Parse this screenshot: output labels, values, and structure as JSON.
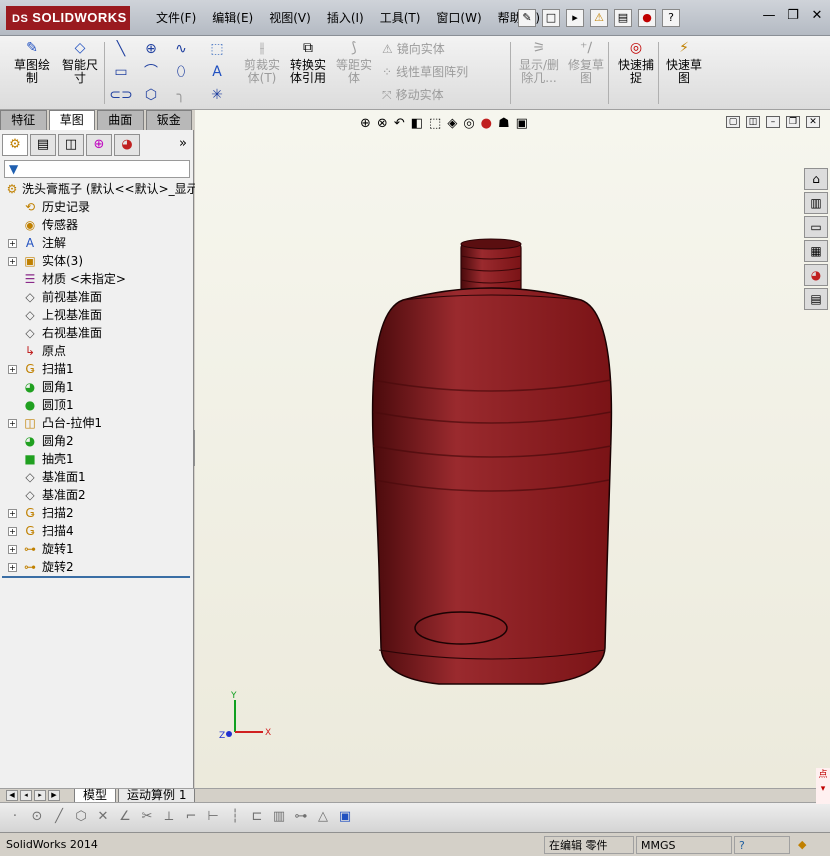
{
  "app": {
    "logo_text": "SOLIDWORKS",
    "logo_prefix": "DS"
  },
  "menus": [
    "文件(F)",
    "编辑(E)",
    "视图(V)",
    "插入(I)",
    "工具(T)",
    "窗口(W)",
    "帮助(H)"
  ],
  "titletools": [
    "pin-icon",
    "new-document-icon",
    "open-icon",
    "rebuild-warning-icon",
    "print-icon",
    "traffic-light-icon",
    "help-icon"
  ],
  "window_buttons": {
    "min": "—",
    "restore": "❐",
    "close": "✕"
  },
  "toolbar": {
    "sketch": "草图绘\n制",
    "smart_dim": "智能尺\n寸",
    "trim": "剪裁实\n体(T)",
    "convert": "转换实\n体引用",
    "offset": "等距实\n体",
    "mirror": "镜向实体",
    "linear_pattern": "线性草图阵列",
    "move": "移动实体",
    "show_delete": "显示/删\n除几...",
    "repair": "修复草\n图",
    "quick_snap": "快速捕\n捉",
    "rapid_sketch": "快速草\n图"
  },
  "cmd_tabs": [
    {
      "label": "特征",
      "active": false
    },
    {
      "label": "草图",
      "active": true
    },
    {
      "label": "曲面",
      "active": false
    },
    {
      "label": "钣金",
      "active": false
    }
  ],
  "panel": {
    "more": "»",
    "filter_icon": "filter-icon"
  },
  "tree": {
    "root": "洗头膏瓶子  (默认<<默认>_显示",
    "items": [
      {
        "label": "历史记录",
        "icon": "history-icon",
        "expand": false
      },
      {
        "label": "传感器",
        "icon": "sensor-icon",
        "expand": false
      },
      {
        "label": "注解",
        "icon": "annotation-icon",
        "expand": true
      },
      {
        "label": "实体(3)",
        "icon": "solid-bodies-icon",
        "expand": true
      },
      {
        "label": "材质 <未指定>",
        "icon": "material-icon",
        "expand": false
      },
      {
        "label": "前视基准面",
        "icon": "plane-icon",
        "expand": false
      },
      {
        "label": "上视基准面",
        "icon": "plane-icon",
        "expand": false
      },
      {
        "label": "右视基准面",
        "icon": "plane-icon",
        "expand": false
      },
      {
        "label": "原点",
        "icon": "origin-icon",
        "expand": false
      },
      {
        "label": "扫描1",
        "icon": "sweep-icon",
        "expand": true
      },
      {
        "label": "圆角1",
        "icon": "fillet-icon",
        "expand": false
      },
      {
        "label": "圆顶1",
        "icon": "dome-icon",
        "expand": false
      },
      {
        "label": "凸台-拉伸1",
        "icon": "extrude-icon",
        "expand": true
      },
      {
        "label": "圆角2",
        "icon": "fillet-icon",
        "expand": false
      },
      {
        "label": "抽壳1",
        "icon": "shell-icon",
        "expand": false
      },
      {
        "label": "基准面1",
        "icon": "plane-icon",
        "expand": false
      },
      {
        "label": "基准面2",
        "icon": "plane-icon",
        "expand": false
      },
      {
        "label": "扫描2",
        "icon": "sweep-icon",
        "expand": true
      },
      {
        "label": "扫描4",
        "icon": "sweep-icon",
        "expand": true
      },
      {
        "label": "旋转1",
        "icon": "revolve-icon",
        "expand": true
      },
      {
        "label": "旋转2",
        "icon": "revolve-icon",
        "expand": true
      }
    ]
  },
  "bottom_tabs": [
    {
      "label": "模型",
      "active": true
    },
    {
      "label": "运动算例 1",
      "active": false
    }
  ],
  "triad": {
    "x": "X",
    "y": "Y",
    "z": "Z"
  },
  "status": {
    "app": "SolidWorks 2014",
    "mode": "在编辑 零件",
    "units": "MMGS",
    "help": "?"
  },
  "colors": {
    "bottle": "#7a1316",
    "bottle_highlight": "#9a2a2e",
    "brand": "#9a1a1f"
  }
}
